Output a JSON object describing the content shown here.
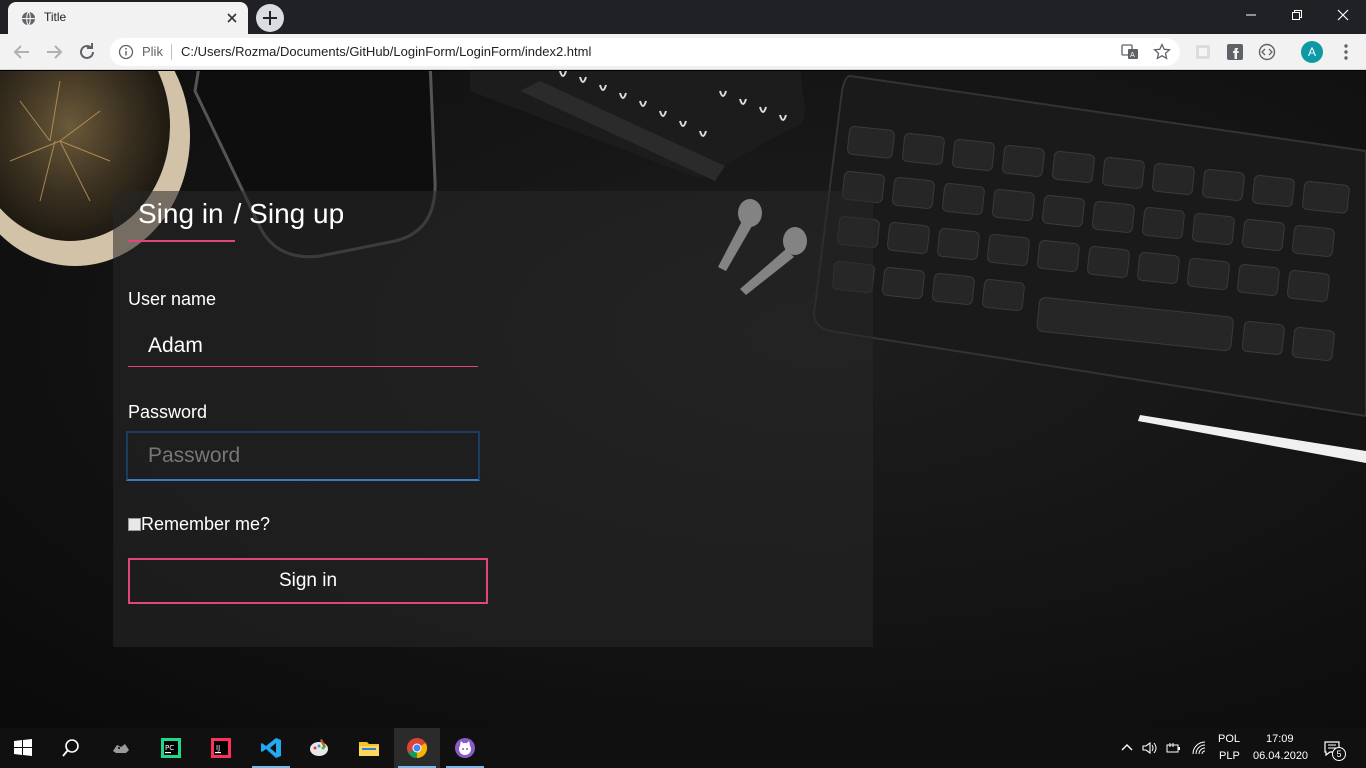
{
  "browser": {
    "tab_title": "Title",
    "scheme_label": "Plik",
    "url": "C:/Users/Rozma/Documents/GitHub/LoginForm/LoginForm/index2.html",
    "profile_initial": "A",
    "accent_color": "#0d9aa4"
  },
  "page": {
    "heading_active": "Sing in",
    "heading_other": "/ Sing up",
    "username_label": "User name",
    "username_value": "Adam",
    "password_label": "Password",
    "password_placeholder": "Password",
    "remember_label": "Remember me?",
    "signin_label": "Sign in",
    "accent_color": "#e0457b"
  },
  "taskbar": {
    "icons": [
      "windows-start-icon",
      "search-icon",
      "cat-app-icon",
      "pycharm-icon",
      "intellij-icon",
      "vscode-icon",
      "paint-icon",
      "file-explorer-icon",
      "chrome-icon",
      "github-desktop-icon"
    ],
    "language_top": "POL",
    "language_bottom": "PLP",
    "time": "17:09",
    "date": "06.04.2020",
    "notification_count": "5"
  }
}
